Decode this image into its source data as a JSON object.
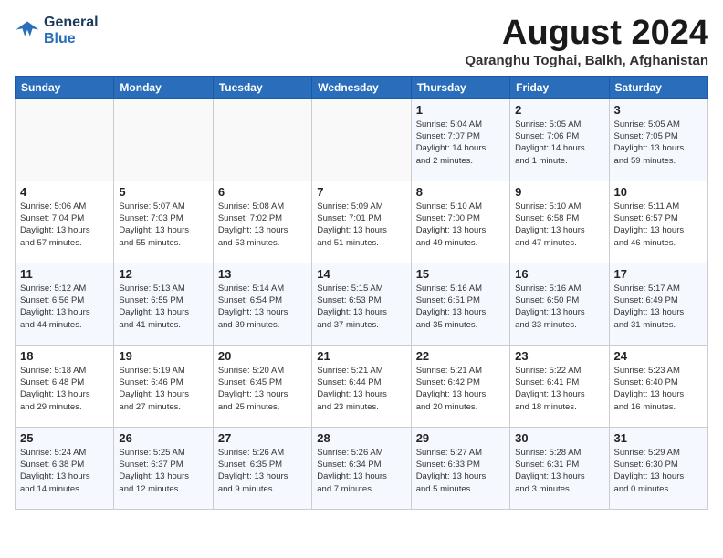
{
  "header": {
    "logo_line1": "General",
    "logo_line2": "Blue",
    "month_year": "August 2024",
    "location": "Qaranghu Toghai, Balkh, Afghanistan"
  },
  "days_of_week": [
    "Sunday",
    "Monday",
    "Tuesday",
    "Wednesday",
    "Thursday",
    "Friday",
    "Saturday"
  ],
  "weeks": [
    [
      {
        "day": "",
        "info": ""
      },
      {
        "day": "",
        "info": ""
      },
      {
        "day": "",
        "info": ""
      },
      {
        "day": "",
        "info": ""
      },
      {
        "day": "1",
        "info": "Sunrise: 5:04 AM\nSunset: 7:07 PM\nDaylight: 14 hours\nand 2 minutes."
      },
      {
        "day": "2",
        "info": "Sunrise: 5:05 AM\nSunset: 7:06 PM\nDaylight: 14 hours\nand 1 minute."
      },
      {
        "day": "3",
        "info": "Sunrise: 5:05 AM\nSunset: 7:05 PM\nDaylight: 13 hours\nand 59 minutes."
      }
    ],
    [
      {
        "day": "4",
        "info": "Sunrise: 5:06 AM\nSunset: 7:04 PM\nDaylight: 13 hours\nand 57 minutes."
      },
      {
        "day": "5",
        "info": "Sunrise: 5:07 AM\nSunset: 7:03 PM\nDaylight: 13 hours\nand 55 minutes."
      },
      {
        "day": "6",
        "info": "Sunrise: 5:08 AM\nSunset: 7:02 PM\nDaylight: 13 hours\nand 53 minutes."
      },
      {
        "day": "7",
        "info": "Sunrise: 5:09 AM\nSunset: 7:01 PM\nDaylight: 13 hours\nand 51 minutes."
      },
      {
        "day": "8",
        "info": "Sunrise: 5:10 AM\nSunset: 7:00 PM\nDaylight: 13 hours\nand 49 minutes."
      },
      {
        "day": "9",
        "info": "Sunrise: 5:10 AM\nSunset: 6:58 PM\nDaylight: 13 hours\nand 47 minutes."
      },
      {
        "day": "10",
        "info": "Sunrise: 5:11 AM\nSunset: 6:57 PM\nDaylight: 13 hours\nand 46 minutes."
      }
    ],
    [
      {
        "day": "11",
        "info": "Sunrise: 5:12 AM\nSunset: 6:56 PM\nDaylight: 13 hours\nand 44 minutes."
      },
      {
        "day": "12",
        "info": "Sunrise: 5:13 AM\nSunset: 6:55 PM\nDaylight: 13 hours\nand 41 minutes."
      },
      {
        "day": "13",
        "info": "Sunrise: 5:14 AM\nSunset: 6:54 PM\nDaylight: 13 hours\nand 39 minutes."
      },
      {
        "day": "14",
        "info": "Sunrise: 5:15 AM\nSunset: 6:53 PM\nDaylight: 13 hours\nand 37 minutes."
      },
      {
        "day": "15",
        "info": "Sunrise: 5:16 AM\nSunset: 6:51 PM\nDaylight: 13 hours\nand 35 minutes."
      },
      {
        "day": "16",
        "info": "Sunrise: 5:16 AM\nSunset: 6:50 PM\nDaylight: 13 hours\nand 33 minutes."
      },
      {
        "day": "17",
        "info": "Sunrise: 5:17 AM\nSunset: 6:49 PM\nDaylight: 13 hours\nand 31 minutes."
      }
    ],
    [
      {
        "day": "18",
        "info": "Sunrise: 5:18 AM\nSunset: 6:48 PM\nDaylight: 13 hours\nand 29 minutes."
      },
      {
        "day": "19",
        "info": "Sunrise: 5:19 AM\nSunset: 6:46 PM\nDaylight: 13 hours\nand 27 minutes."
      },
      {
        "day": "20",
        "info": "Sunrise: 5:20 AM\nSunset: 6:45 PM\nDaylight: 13 hours\nand 25 minutes."
      },
      {
        "day": "21",
        "info": "Sunrise: 5:21 AM\nSunset: 6:44 PM\nDaylight: 13 hours\nand 23 minutes."
      },
      {
        "day": "22",
        "info": "Sunrise: 5:21 AM\nSunset: 6:42 PM\nDaylight: 13 hours\nand 20 minutes."
      },
      {
        "day": "23",
        "info": "Sunrise: 5:22 AM\nSunset: 6:41 PM\nDaylight: 13 hours\nand 18 minutes."
      },
      {
        "day": "24",
        "info": "Sunrise: 5:23 AM\nSunset: 6:40 PM\nDaylight: 13 hours\nand 16 minutes."
      }
    ],
    [
      {
        "day": "25",
        "info": "Sunrise: 5:24 AM\nSunset: 6:38 PM\nDaylight: 13 hours\nand 14 minutes."
      },
      {
        "day": "26",
        "info": "Sunrise: 5:25 AM\nSunset: 6:37 PM\nDaylight: 13 hours\nand 12 minutes."
      },
      {
        "day": "27",
        "info": "Sunrise: 5:26 AM\nSunset: 6:35 PM\nDaylight: 13 hours\nand 9 minutes."
      },
      {
        "day": "28",
        "info": "Sunrise: 5:26 AM\nSunset: 6:34 PM\nDaylight: 13 hours\nand 7 minutes."
      },
      {
        "day": "29",
        "info": "Sunrise: 5:27 AM\nSunset: 6:33 PM\nDaylight: 13 hours\nand 5 minutes."
      },
      {
        "day": "30",
        "info": "Sunrise: 5:28 AM\nSunset: 6:31 PM\nDaylight: 13 hours\nand 3 minutes."
      },
      {
        "day": "31",
        "info": "Sunrise: 5:29 AM\nSunset: 6:30 PM\nDaylight: 13 hours\nand 0 minutes."
      }
    ]
  ]
}
